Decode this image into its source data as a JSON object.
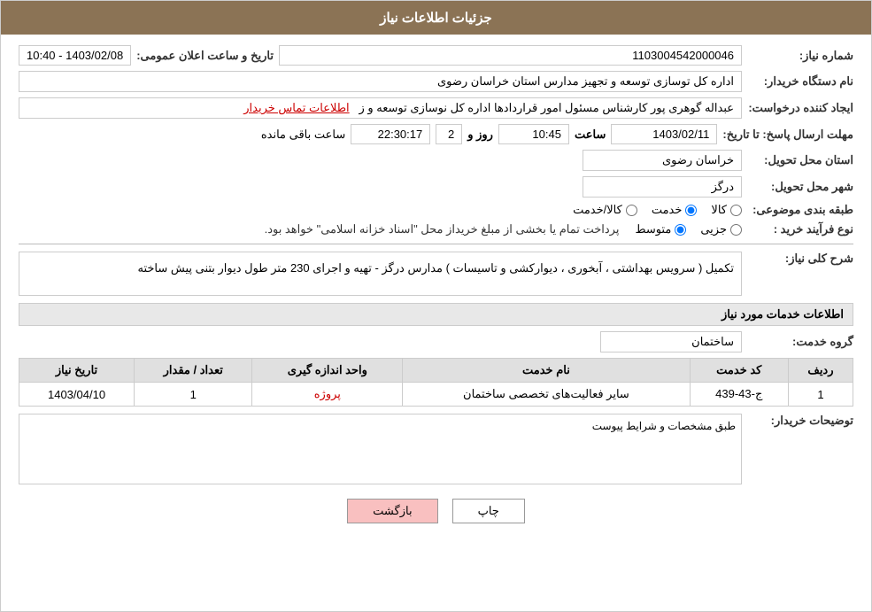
{
  "header": {
    "title": "جزئیات اطلاعات نیاز"
  },
  "fields": {
    "request_number_label": "شماره نیاز:",
    "request_number_value": "1103004542000046",
    "buyer_org_label": "نام دستگاه خریدار:",
    "buyer_org_value": "اداره کل توسازی  توسعه و تجهیز مدارس استان خراسان رضوی",
    "creator_label": "ایجاد کننده درخواست:",
    "creator_value": "عبداله گوهری پور کارشناس مسئول امور قراردادها  اداره کل نوسازی  توسعه و ز",
    "creator_link": "اطلاعات تماس خریدار",
    "send_date_label": "مهلت ارسال پاسخ: تا تاریخ:",
    "send_date_value": "1403/02/11",
    "send_time_value": "10:45",
    "send_days": "2",
    "send_remaining": "22:30:17",
    "remaining_label": "ساعت باقی مانده",
    "province_label": "استان محل تحویل:",
    "province_value": "خراسان رضوی",
    "city_label": "شهر محل تحویل:",
    "city_value": "درگز",
    "category_label": "طبقه بندی موضوعی:",
    "category_options": [
      {
        "id": "kala",
        "label": "کالا"
      },
      {
        "id": "khadamat",
        "label": "خدمت"
      },
      {
        "id": "kala_khadamat",
        "label": "کالا/خدمت"
      }
    ],
    "category_selected": "khadamat",
    "purchase_type_label": "نوع فرآیند خرید :",
    "purchase_type_options": [
      {
        "id": "jozii",
        "label": "جزیی"
      },
      {
        "id": "motavaset",
        "label": "متوسط"
      }
    ],
    "purchase_type_selected": "motavaset",
    "purchase_type_note": "پرداخت تمام یا بخشی از مبلغ خریداز محل \"اسناد خزانه اسلامی\" خواهد بود.",
    "announce_date_label": "تاریخ و ساعت اعلان عمومی:",
    "announce_date_value": "1403/02/08 - 10:40",
    "description_label": "شرح کلی نیاز:",
    "description_value": "تکمیل ( سرویس بهداشتی ، آبخوری ، دیوارکشی و تاسیسات ) مدارس درگز - تهیه و اجرای 230 متر طول دیوار بتنی پیش ساخته",
    "services_section_title": "اطلاعات خدمات مورد نیاز",
    "service_group_label": "گروه خدمت:",
    "service_group_value": "ساختمان",
    "table_headers": [
      "ردیف",
      "کد خدمت",
      "نام خدمت",
      "واحد اندازه گیری",
      "تعداد / مقدار",
      "تاریخ نیاز"
    ],
    "table_rows": [
      {
        "row": "1",
        "code": "ج-43-439",
        "name": "سایر فعالیت‌های تخصصی ساختمان",
        "unit": "پروژه",
        "count": "1",
        "date": "1403/04/10"
      }
    ],
    "buyer_notes_label": "توضیحات خریدار:",
    "buyer_notes_value": "طبق مشخصات و شرایط پیوست",
    "btn_print": "چاپ",
    "btn_back": "بازگشت"
  }
}
